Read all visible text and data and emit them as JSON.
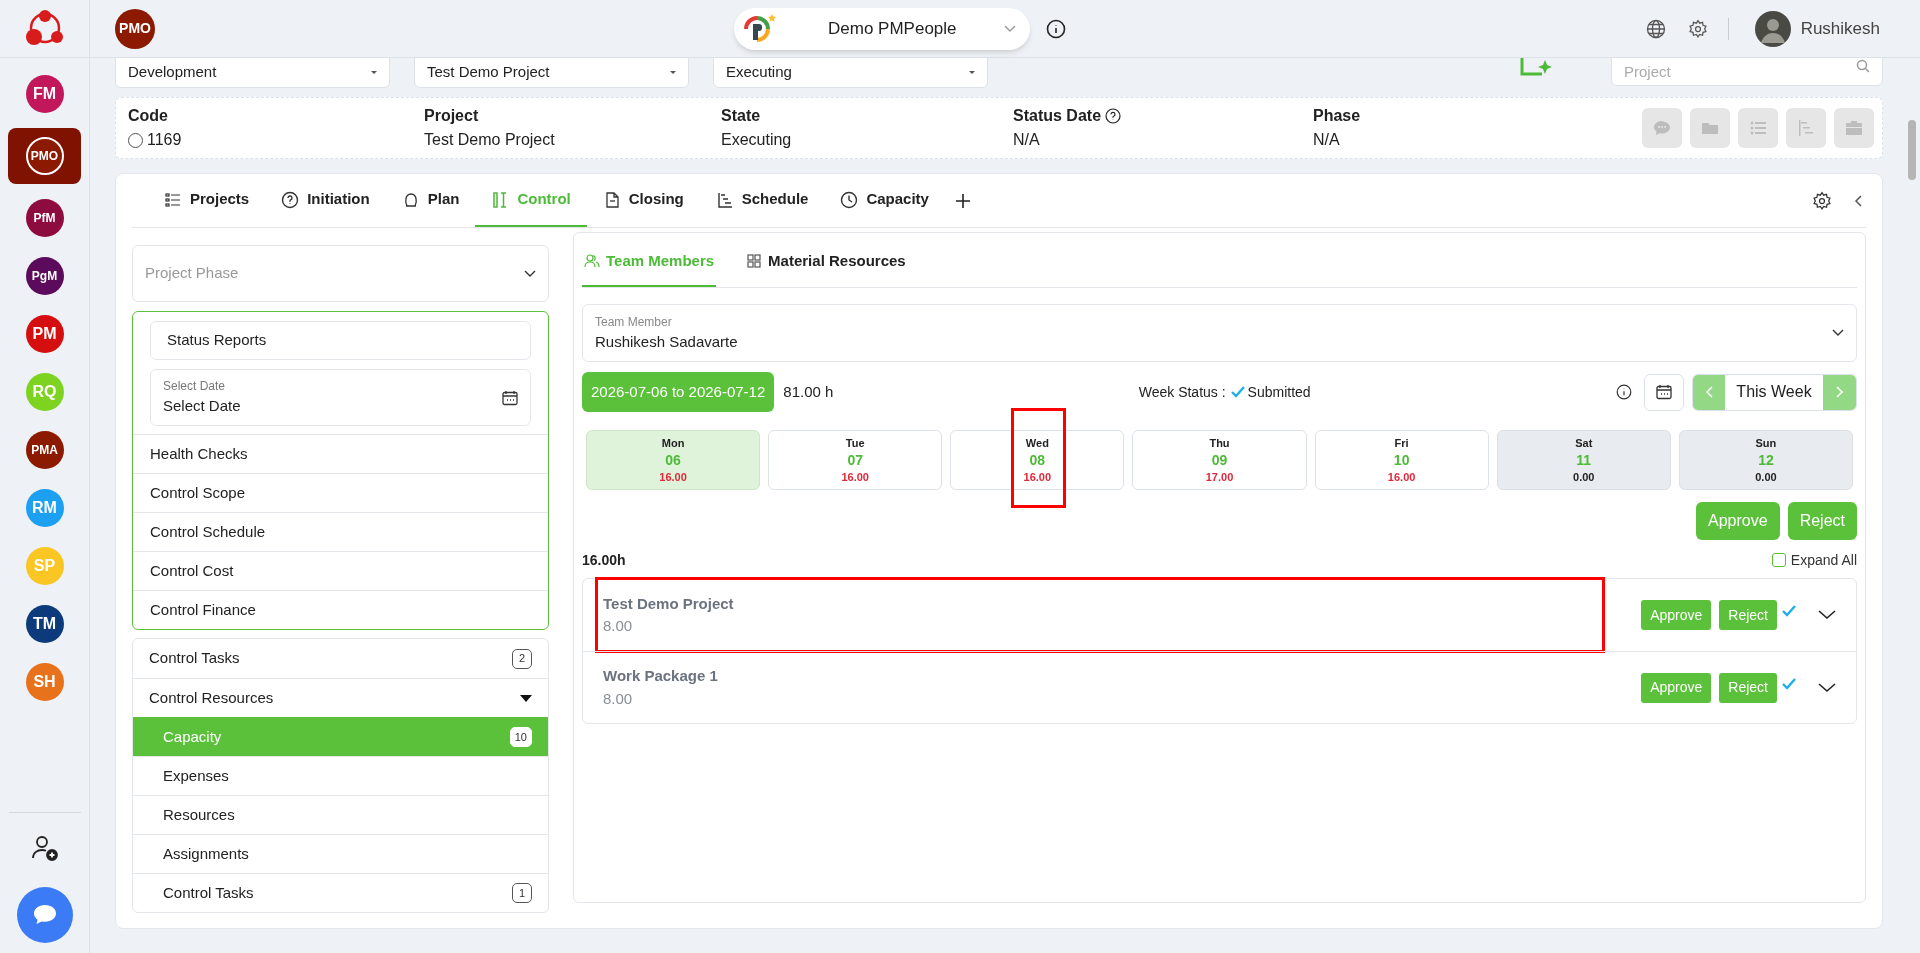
{
  "rail": {
    "apps": [
      {
        "label": "FM",
        "color": "#c2185b",
        "selected": false
      },
      {
        "label": "PMO",
        "color": "#8b1a00",
        "selected": true
      },
      {
        "label": "PfM",
        "color": "#8e0b3f",
        "selected": false
      },
      {
        "label": "PgM",
        "color": "#5b0a5c",
        "selected": false
      },
      {
        "label": "PM",
        "color": "#d50f0f",
        "selected": false
      },
      {
        "label": "RQ",
        "color": "#7ed321",
        "selected": false
      },
      {
        "label": "PMA",
        "color": "#8b1a00",
        "selected": false
      },
      {
        "label": "RM",
        "color": "#1ea0f2",
        "selected": false
      },
      {
        "label": "SP",
        "color": "#f9c623",
        "selected": false
      },
      {
        "label": "TM",
        "color": "#0d3a7a",
        "selected": false
      },
      {
        "label": "SH",
        "color": "#e8711c",
        "selected": false
      }
    ]
  },
  "header": {
    "badge": "PMO",
    "workspace": "Demo PMPeople",
    "user": "Rushikesh"
  },
  "filters": [
    {
      "value": "Development"
    },
    {
      "value": "Test Demo Project"
    },
    {
      "value": "Executing"
    }
  ],
  "search": {
    "placeholder": "Project"
  },
  "info": {
    "fields": [
      {
        "label": "Code",
        "value": "1169",
        "kind": "radio",
        "checked": false
      },
      {
        "label": "Project",
        "value": "Test Demo Project",
        "kind": "plain"
      },
      {
        "label": "State",
        "value": "Executing",
        "kind": "plain"
      },
      {
        "label": "Status Date",
        "value": "N/A",
        "kind": "help"
      },
      {
        "label": "Phase",
        "value": "N/A",
        "kind": "plain"
      }
    ]
  },
  "tabs": [
    {
      "label": "Projects",
      "selected": false
    },
    {
      "label": "Initiation",
      "selected": false
    },
    {
      "label": "Plan",
      "selected": false
    },
    {
      "label": "Control",
      "selected": true
    },
    {
      "label": "Closing",
      "selected": false
    },
    {
      "label": "Schedule",
      "selected": false
    },
    {
      "label": "Capacity",
      "selected": false
    }
  ],
  "phase_select": {
    "placeholder": "Project Phase"
  },
  "status_reports": {
    "value": "Status Reports"
  },
  "date_field": {
    "label": "Select Date",
    "placeholder": "Select Date"
  },
  "control_items": [
    "Health Checks",
    "Control Scope",
    "Control Schedule",
    "Control Cost",
    "Control Finance"
  ],
  "menu": [
    {
      "label": "Control Tasks",
      "count": "2"
    },
    {
      "label": "Control Resources",
      "expanded": true,
      "children": [
        {
          "label": "Capacity",
          "count": "10",
          "selected": true
        },
        {
          "label": "Expenses",
          "selected": false
        },
        {
          "label": "Resources",
          "selected": false
        },
        {
          "label": "Assignments",
          "selected": false
        },
        {
          "label": "Control Tasks",
          "count": "1",
          "selected": false
        }
      ]
    }
  ],
  "subtabs": [
    {
      "label": "Team Members",
      "selected": true
    },
    {
      "label": "Material Resources",
      "selected": false
    }
  ],
  "team_member": {
    "label": "Team Member",
    "value": "Rushikesh Sadavarte"
  },
  "week": {
    "range": "2026-07-06 to 2026-07-12",
    "total": "81.00 h",
    "status_label": "Week Status :",
    "status": "Submitted",
    "nav_label": "This Week"
  },
  "days": [
    {
      "day": "Mon",
      "date": "06",
      "hours": "16.00",
      "selected": true,
      "weekend": false,
      "highlighted": false
    },
    {
      "day": "Tue",
      "date": "07",
      "hours": "16.00",
      "selected": false,
      "weekend": false,
      "highlighted": false
    },
    {
      "day": "Wed",
      "date": "08",
      "hours": "16.00",
      "selected": false,
      "weekend": false,
      "highlighted": true
    },
    {
      "day": "Thu",
      "date": "09",
      "hours": "17.00",
      "selected": false,
      "weekend": false,
      "highlighted": false
    },
    {
      "day": "Fri",
      "date": "10",
      "hours": "16.00",
      "selected": false,
      "weekend": false,
      "highlighted": false
    },
    {
      "day": "Sat",
      "date": "11",
      "hours": "0.00",
      "selected": false,
      "weekend": true,
      "highlighted": false
    },
    {
      "day": "Sun",
      "date": "12",
      "hours": "0.00",
      "selected": false,
      "weekend": true,
      "highlighted": false
    }
  ],
  "week_actions": [
    "Approve",
    "Reject"
  ],
  "day_total": "16.00h",
  "expand_all": {
    "label": "Expand All",
    "checked": false
  },
  "entries": [
    {
      "name": "Test Demo Project",
      "hours": "8.00",
      "actions": [
        "Approve",
        "Reject"
      ],
      "approved": true,
      "highlighted": true
    },
    {
      "name": "Work Package 1",
      "hours": "8.00",
      "actions": [
        "Approve",
        "Reject"
      ],
      "approved": true,
      "highlighted": false
    }
  ]
}
